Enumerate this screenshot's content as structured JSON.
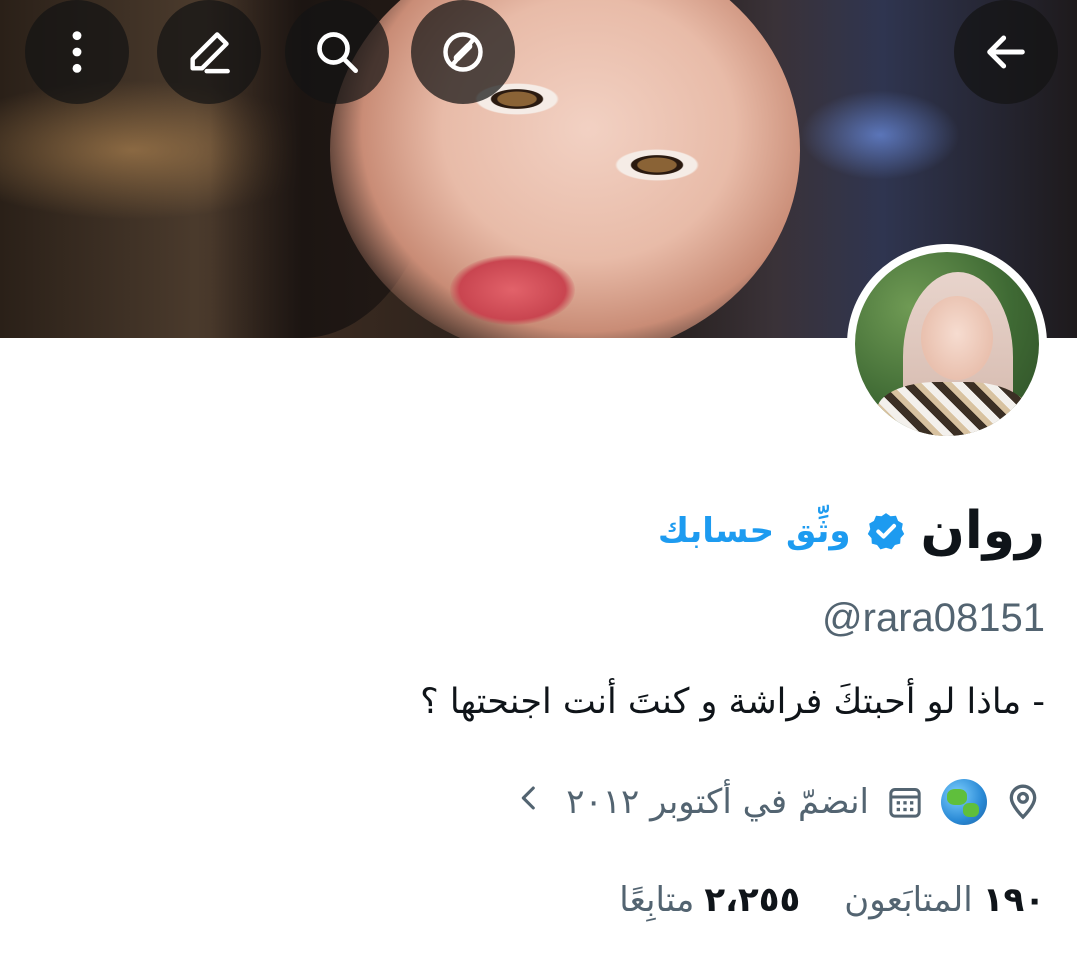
{
  "header": {
    "back_icon": "arrow-left-icon",
    "actions": [
      {
        "icon": "more-vertical-icon"
      },
      {
        "icon": "edit-icon"
      },
      {
        "icon": "search-icon"
      },
      {
        "icon": "compass-icon"
      }
    ]
  },
  "profile": {
    "display_name": "روان",
    "verify_link": "وثِّق حسابك",
    "handle": "@rara08151",
    "bio": "- ماذا لو أحبتكَ فراشة و كنتَ أنت اجنحتها ؟",
    "location_icon": "globe-icon",
    "joined": "انضمّ في أكتوبر ٢٠١٢",
    "following_count": "٢،٢٥٥",
    "following_label": "متابِعًا",
    "followers_count": "١٩٠",
    "followers_label": "المتابَعون"
  },
  "colors": {
    "accent": "#1d9bf0",
    "text_primary": "#0f1419",
    "text_secondary": "#536471"
  }
}
